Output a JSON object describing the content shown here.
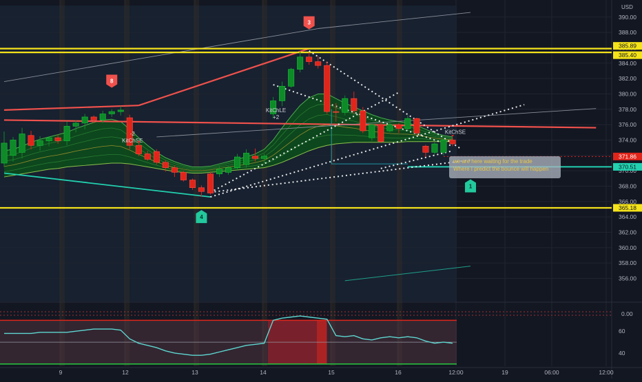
{
  "currency": "USD",
  "colors": {
    "background": "#131722",
    "grid": "#1f2430",
    "up": "#089981",
    "up_fill": "#0e8a28",
    "down": "#e0251b",
    "yellow": "#f5e31a",
    "red_line": "#f0514c",
    "teal": "#22d1b0",
    "rsi": "#5ed7d1",
    "text": "#b2b5be"
  },
  "chart_data": [
    {
      "type": "candlestick",
      "title": "",
      "xlabel": "",
      "ylabel": "",
      "ylim": [
        353.0,
        391.5
      ],
      "x_tick_labels": [
        "9",
        "12",
        "13",
        "14",
        "15",
        "16",
        "12:00",
        "19",
        "06:00",
        "12:00"
      ],
      "y_tick_labels": [
        "356.00",
        "358.00",
        "360.00",
        "362.00",
        "364.00",
        "366.00",
        "368.00",
        "370.00",
        "372.00",
        "374.00",
        "376.00",
        "378.00",
        "380.00",
        "382.00",
        "384.00",
        "386.00",
        "388.00",
        "390.00"
      ],
      "candles": [
        {
          "o": 371.0,
          "h": 375.1,
          "l": 370.5,
          "c": 373.6
        },
        {
          "o": 372.0,
          "h": 374.4,
          "l": 371.2,
          "c": 374.0
        },
        {
          "o": 372.4,
          "h": 375.6,
          "l": 371.6,
          "c": 374.8
        },
        {
          "o": 374.6,
          "h": 375.2,
          "l": 372.8,
          "c": 373.3
        },
        {
          "o": 373.3,
          "h": 374.5,
          "l": 372.6,
          "c": 373.9
        },
        {
          "o": 373.9,
          "h": 374.5,
          "l": 373.2,
          "c": 374.3
        },
        {
          "o": 374.3,
          "h": 374.7,
          "l": 373.5,
          "c": 373.9
        },
        {
          "o": 373.9,
          "h": 376.4,
          "l": 373.3,
          "c": 375.8
        },
        {
          "o": 375.8,
          "h": 376.6,
          "l": 375.0,
          "c": 376.2
        },
        {
          "o": 376.2,
          "h": 377.4,
          "l": 375.4,
          "c": 377.0
        },
        {
          "o": 377.0,
          "h": 377.2,
          "l": 376.2,
          "c": 376.6
        },
        {
          "o": 376.6,
          "h": 377.8,
          "l": 376.2,
          "c": 377.4
        },
        {
          "o": 377.4,
          "h": 378.0,
          "l": 377.0,
          "c": 377.7
        },
        {
          "o": 377.7,
          "h": 378.4,
          "l": 377.2,
          "c": 377.9
        },
        {
          "o": 376.9,
          "h": 377.3,
          "l": 372.8,
          "c": 373.3
        },
        {
          "o": 373.3,
          "h": 373.7,
          "l": 371.9,
          "c": 372.2
        },
        {
          "o": 372.2,
          "h": 372.6,
          "l": 371.3,
          "c": 371.5
        },
        {
          "o": 372.5,
          "h": 372.8,
          "l": 370.8,
          "c": 371.1
        },
        {
          "o": 371.1,
          "h": 371.4,
          "l": 369.9,
          "c": 370.4
        },
        {
          "o": 370.4,
          "h": 370.7,
          "l": 369.2,
          "c": 369.8
        },
        {
          "o": 369.8,
          "h": 370.0,
          "l": 368.6,
          "c": 368.8
        },
        {
          "o": 368.8,
          "h": 369.0,
          "l": 367.5,
          "c": 367.8
        },
        {
          "o": 367.8,
          "h": 368.1,
          "l": 366.6,
          "c": 367.3
        },
        {
          "o": 369.6,
          "h": 369.9,
          "l": 366.9,
          "c": 367.1
        },
        {
          "o": 369.6,
          "h": 370.6,
          "l": 369.2,
          "c": 370.2
        },
        {
          "o": 369.8,
          "h": 370.6,
          "l": 369.5,
          "c": 370.4
        },
        {
          "o": 370.4,
          "h": 372.2,
          "l": 370.1,
          "c": 371.8
        },
        {
          "o": 370.8,
          "h": 372.8,
          "l": 370.4,
          "c": 372.3
        },
        {
          "o": 371.9,
          "h": 372.9,
          "l": 371.2,
          "c": 371.6
        },
        {
          "o": 371.6,
          "h": 372.2,
          "l": 371.0,
          "c": 371.9
        },
        {
          "o": 377.4,
          "h": 379.6,
          "l": 376.8,
          "c": 379.1
        },
        {
          "o": 379.1,
          "h": 381.6,
          "l": 378.4,
          "c": 381.0
        },
        {
          "o": 381.0,
          "h": 383.4,
          "l": 380.8,
          "c": 383.2
        },
        {
          "o": 383.2,
          "h": 385.5,
          "l": 382.8,
          "c": 384.8
        },
        {
          "o": 384.8,
          "h": 385.4,
          "l": 383.8,
          "c": 384.2
        },
        {
          "o": 384.2,
          "h": 384.9,
          "l": 383.3,
          "c": 383.7
        },
        {
          "o": 383.7,
          "h": 384.2,
          "l": 377.4,
          "c": 377.7
        },
        {
          "o": 377.7,
          "h": 378.8,
          "l": 376.4,
          "c": 377.6
        },
        {
          "o": 377.6,
          "h": 379.8,
          "l": 377.2,
          "c": 379.4
        },
        {
          "o": 379.4,
          "h": 380.3,
          "l": 377.4,
          "c": 377.8
        },
        {
          "o": 377.8,
          "h": 378.3,
          "l": 374.9,
          "c": 375.2
        },
        {
          "o": 374.3,
          "h": 376.2,
          "l": 373.9,
          "c": 376.0
        },
        {
          "o": 376.0,
          "h": 376.3,
          "l": 373.6,
          "c": 373.8
        },
        {
          "o": 375.2,
          "h": 376.4,
          "l": 375.0,
          "c": 376.0
        },
        {
          "o": 376.0,
          "h": 376.2,
          "l": 374.9,
          "c": 375.5
        },
        {
          "o": 375.5,
          "h": 377.2,
          "l": 375.2,
          "c": 376.8
        },
        {
          "o": 376.8,
          "h": 376.9,
          "l": 374.7,
          "c": 374.9
        },
        {
          "o": 373.2,
          "h": 373.4,
          "l": 371.8,
          "c": 372.4
        },
        {
          "o": 372.4,
          "h": 373.7,
          "l": 372.1,
          "c": 373.5
        },
        {
          "o": 372.4,
          "h": 374.2,
          "l": 372.0,
          "c": 374.0
        },
        {
          "o": 374.0,
          "h": 374.3,
          "l": 373.2,
          "c": 373.5
        }
      ],
      "indicator_band": {
        "upper": [
          372.6,
          372.8,
          373.2,
          373.7,
          374.1,
          374.4,
          374.7,
          375.0,
          375.5,
          375.9,
          376.3,
          376.6,
          376.7,
          376.4,
          375.4,
          374.3,
          373.3,
          372.4,
          371.7,
          371.2,
          370.8,
          370.5,
          370.5,
          370.6,
          370.9,
          371.2,
          371.5,
          371.8,
          372.2,
          372.8,
          374.0,
          375.6,
          377.1,
          378.5,
          379.5,
          380.0,
          380.0,
          379.4,
          378.8,
          378.3,
          377.8,
          377.3,
          376.9,
          376.6,
          376.4,
          376.2,
          375.9,
          375.4,
          374.9,
          374.6,
          374.4
        ],
        "lower": [
          369.2,
          369.4,
          369.6,
          369.8,
          370.0,
          370.2,
          370.3,
          370.5,
          370.6,
          370.7,
          370.8,
          370.9,
          371.0,
          371.0,
          370.9,
          370.7,
          370.5,
          370.3,
          370.1,
          369.9,
          369.8,
          369.7,
          369.7,
          369.8,
          369.9,
          370.0,
          370.1,
          370.2,
          370.3,
          370.4,
          370.7,
          371.1,
          371.6,
          372.1,
          372.6,
          373.0,
          373.3,
          373.5,
          373.6,
          373.7,
          373.7,
          373.7,
          373.7,
          373.7,
          373.7,
          373.8,
          373.8,
          373.8,
          373.8,
          373.8,
          373.8
        ]
      },
      "horizontal_levels": [
        {
          "price": 385.89,
          "label": "385.89",
          "kind": "yellow"
        },
        {
          "price": 385.4,
          "label": "385.40",
          "kind": "yellow"
        },
        {
          "price": 365.18,
          "label": "365.18",
          "kind": "yellow"
        },
        {
          "price": 370.51,
          "label": "370.51",
          "kind": "teal"
        },
        {
          "price": 371.86,
          "label": "371.86",
          "kind": "red-dotted"
        }
      ],
      "trend_lines": [
        {
          "from": [
            0,
            377.9
          ],
          "to": [
            15,
            378.5
          ],
          "kind": "red"
        },
        {
          "from": [
            15,
            378.5
          ],
          "to": [
            34,
            385.9
          ],
          "kind": "red"
        },
        {
          "from": [
            0,
            376.6
          ],
          "to": [
            66,
            375.6
          ],
          "kind": "red"
        },
        {
          "from": [
            0,
            369.7
          ],
          "to": [
            23,
            366.6
          ],
          "kind": "teal"
        },
        {
          "from": [
            0,
            381.6
          ],
          "to": [
            35,
            388.5
          ],
          "kind": "gray"
        },
        {
          "from": [
            35,
            388.5
          ],
          "to": [
            52,
            390.6
          ],
          "kind": "gray"
        },
        {
          "from": [
            17,
            374.4
          ],
          "to": [
            66,
            378.1
          ],
          "kind": "gray"
        },
        {
          "from": [
            38,
            355.7
          ],
          "to": [
            52,
            357.6
          ],
          "kind": "teal-thin"
        }
      ],
      "dotted_lines": [
        {
          "from": [
            23,
            367.2
          ],
          "to": [
            52,
            371.4
          ]
        },
        {
          "from": [
            23,
            366.6
          ],
          "to": [
            58,
            378.6
          ]
        },
        {
          "from": [
            23,
            367.2
          ],
          "to": [
            44,
            380.2
          ]
        },
        {
          "from": [
            34,
            385.6
          ],
          "to": [
            51,
            372.8
          ]
        },
        {
          "from": [
            30,
            381.2
          ],
          "to": [
            50,
            373.2
          ]
        },
        {
          "from": [
            42,
            370.3
          ],
          "to": [
            50,
            372.6
          ]
        }
      ],
      "signal_labels": [
        {
          "candle": 14,
          "price": 374.6,
          "lines": [
            "-2",
            "KitChSE"
          ]
        },
        {
          "candle": 30,
          "price": 377.6,
          "lines": [
            "KitChLE",
            "+2"
          ]
        },
        {
          "candle": 50,
          "price": 374.8,
          "lines": [
            "KitChSE"
          ]
        }
      ],
      "badges": [
        {
          "text": "8",
          "candle": 12,
          "price": 381.7,
          "color": "red"
        },
        {
          "text": "3",
          "candle": 34,
          "price": 389.3,
          "color": "red"
        },
        {
          "text": "4",
          "candle": 22,
          "price": 364.0,
          "color": "teal"
        },
        {
          "text": "1",
          "candle": 52,
          "price": 368.0,
          "color": "teal"
        }
      ],
      "annotation": {
        "lines": [
          "we are here waiting for the trade",
          "Where I predict the bounce will happen"
        ]
      }
    },
    {
      "type": "line",
      "title": "",
      "xlabel": "",
      "ylabel": "",
      "ylim": [
        28,
        86
      ],
      "y_tick_labels": [
        "60",
        "40"
      ],
      "overbought": 70,
      "midline": 50,
      "oversold": 30,
      "series": [
        {
          "values": [
            58,
            58,
            58,
            58,
            59,
            59,
            59,
            59,
            60,
            61,
            62,
            62,
            62,
            61,
            53,
            49,
            47,
            45,
            42,
            40,
            39,
            38,
            38,
            39,
            41,
            43,
            45,
            47,
            48,
            49,
            70,
            72,
            73,
            74,
            73,
            72,
            71,
            56,
            55,
            56,
            53,
            52,
            54,
            55,
            54,
            55,
            54,
            51,
            49,
            50,
            49
          ]
        }
      ]
    }
  ]
}
